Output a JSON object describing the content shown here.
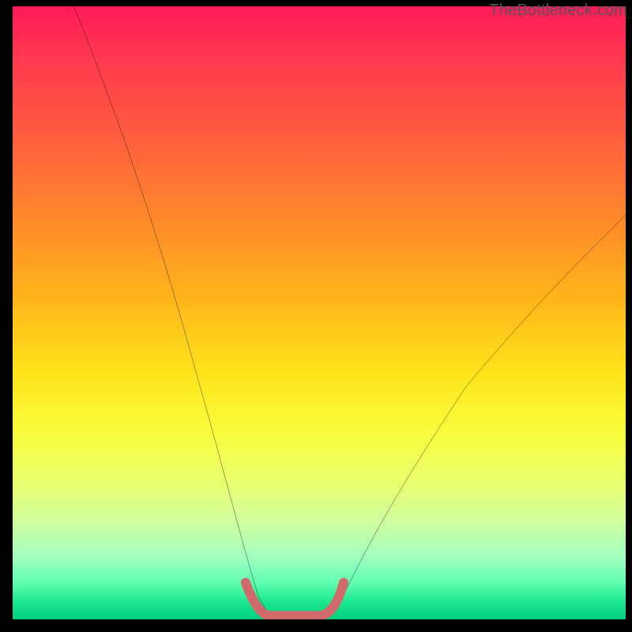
{
  "watermark": {
    "text": "TheBottleneck.com"
  },
  "chart_data": {
    "type": "line",
    "title": "",
    "xlabel": "",
    "ylabel": "",
    "xlim": [
      0,
      100
    ],
    "ylim": [
      0,
      100
    ],
    "background_gradient": {
      "direction": "vertical",
      "stops": [
        {
          "pos": 0,
          "color": "#ff1a5a"
        },
        {
          "pos": 50,
          "color": "#ffd81a"
        },
        {
          "pos": 80,
          "color": "#e8ff70"
        },
        {
          "pos": 100,
          "color": "#00d080"
        }
      ]
    },
    "series": [
      {
        "name": "left-curve",
        "color": "#000000",
        "x": [
          10,
          15,
          20,
          25,
          30,
          35,
          38,
          40,
          42
        ],
        "values": [
          100,
          82,
          65,
          48,
          33,
          18,
          9,
          4,
          2
        ]
      },
      {
        "name": "right-curve",
        "color": "#000000",
        "x": [
          52,
          55,
          60,
          65,
          70,
          80,
          90,
          100
        ],
        "values": [
          2,
          6,
          14,
          22,
          30,
          44,
          56,
          66
        ]
      },
      {
        "name": "valley-marker",
        "color": "#d06a6a",
        "stroke_width": 12,
        "x": [
          38,
          40,
          42,
          45,
          48,
          50,
          52,
          54
        ],
        "values": [
          6,
          2,
          0.5,
          0.5,
          0.5,
          0.5,
          2,
          6
        ]
      }
    ],
    "annotations": []
  }
}
